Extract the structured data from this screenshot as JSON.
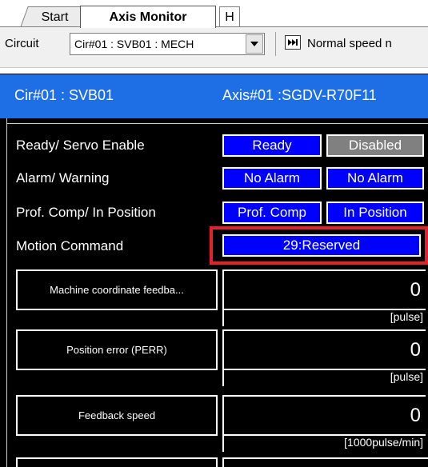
{
  "tabs": [
    {
      "label": "Start"
    },
    {
      "label": "Axis Monitor"
    },
    {
      "label": "H"
    }
  ],
  "toolbar": {
    "circuit_label": "Circuit",
    "circuit_value": "Cir#01 : SVB01 : MECH",
    "speed_label": "Normal speed n",
    "speed_icon": "fast-forward-icon"
  },
  "header": {
    "circuit": "Cir#01  : SVB01",
    "axis": "Axis#01 :SGDV-R70F11"
  },
  "status_rows": [
    {
      "label": "Ready/ Servo Enable",
      "left_value": "Ready",
      "right_value": "Disabled"
    },
    {
      "label": "Alarm/ Warning",
      "left_value": "No Alarm",
      "right_value": "No Alarm"
    },
    {
      "label": "Prof. Comp/ In Position",
      "left_value": "Prof. Comp",
      "right_value": "In Position"
    },
    {
      "label": "Motion Command",
      "value": "29:Reserved"
    }
  ],
  "feedback": [
    {
      "label": "Machine coordinate feedba...",
      "value": "0",
      "unit": "[pulse]"
    },
    {
      "label": "Position error (PERR)",
      "value": "0",
      "unit": "[pulse]"
    },
    {
      "label": "Feedback speed",
      "value": "0",
      "unit": "[1000pulse/min]"
    }
  ],
  "colors": {
    "header_blue": "#1e6fe6",
    "status_blue": "#0000ff",
    "status_gray": "#808080",
    "highlight_red": "#e8202a"
  }
}
